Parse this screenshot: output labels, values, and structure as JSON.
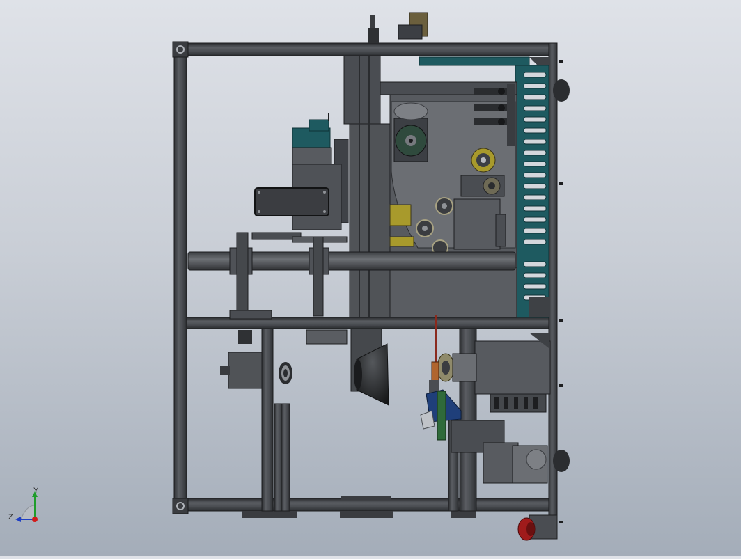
{
  "viewport": {
    "background_top": "#dfe2e8",
    "background_bottom": "#a4adb9"
  },
  "model": {
    "frame_color": "#45484c",
    "frame_dark": "#2b2d30",
    "accent_teal": "#1e5a60",
    "accent_yellow": "#a89a2c",
    "accent_red": "#a01b1b",
    "accent_blue": "#1f3f7a"
  },
  "triad": {
    "x_label": "",
    "y_label": "Y",
    "z_label": "Z",
    "x_color": "#d11b1b",
    "y_color": "#1f9d2b",
    "z_color": "#1f3fc4"
  }
}
